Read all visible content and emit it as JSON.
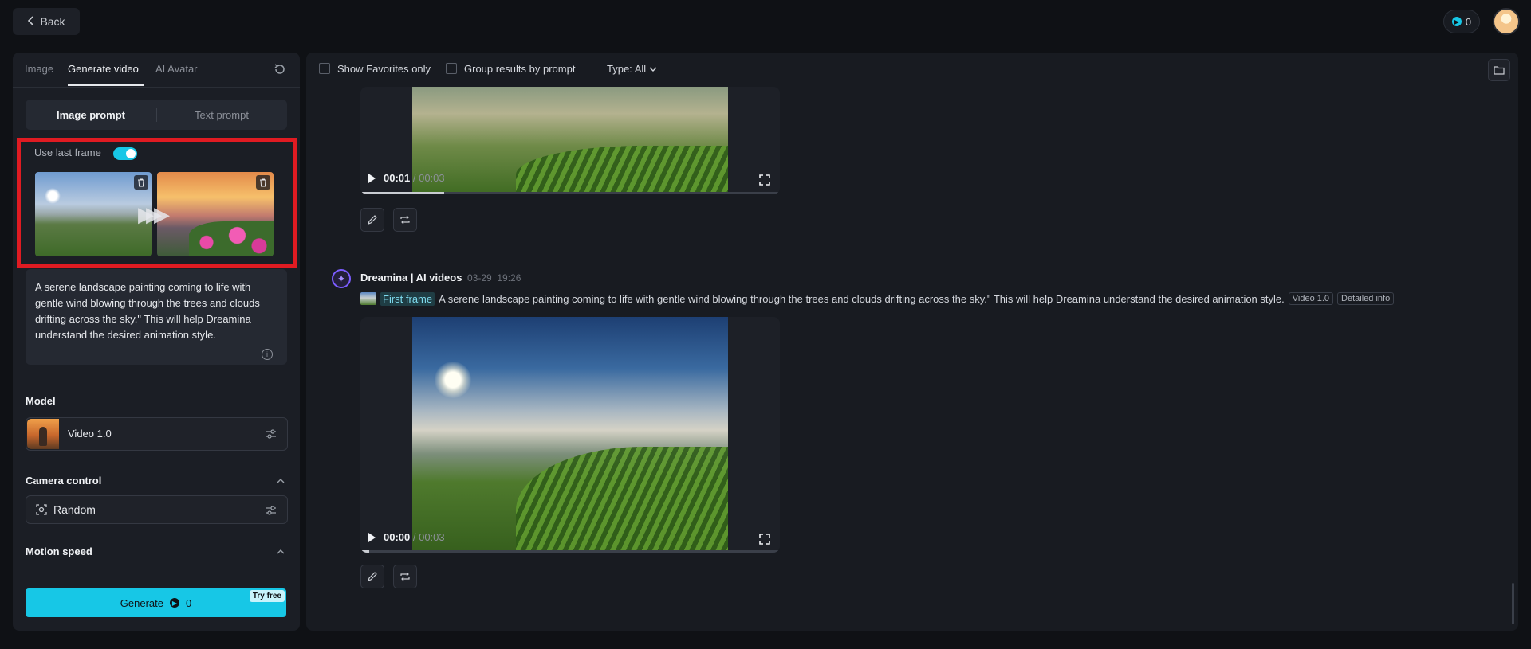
{
  "topbar": {
    "back_label": "Back",
    "credits": "0"
  },
  "left_panel": {
    "tabs": [
      {
        "label": "Image"
      },
      {
        "label": "Generate video"
      },
      {
        "label": "AI Avatar"
      }
    ],
    "prompt_modes": {
      "image": "Image prompt",
      "text": "Text prompt"
    },
    "use_last_frame_label": "Use last frame",
    "use_last_frame_on": true,
    "prompt_text": "A serene landscape painting coming to life with gentle wind blowing through the trees and clouds drifting across the sky.\" This will help Dreamina understand the desired animation style.",
    "model_title": "Model",
    "model_name": "Video 1.0",
    "camera_title": "Camera control",
    "camera_value": "Random",
    "motion_title": "Motion speed",
    "generate_label": "Generate",
    "generate_cost": "0",
    "try_free": "Try free"
  },
  "filters": {
    "favorites": "Show Favorites only",
    "group": "Group results by prompt",
    "type": "Type: All"
  },
  "results": {
    "video_top": {
      "current": "00:01",
      "duration": "/ 00:03",
      "progress": 0.2
    },
    "message": {
      "author": "Dreamina | AI videos",
      "date": "03-29",
      "time": "19:26",
      "first_frame_label": "First frame",
      "prompt": "A serene landscape painting coming to life with gentle wind blowing through the trees and clouds drifting across the sky.\" This will help Dreamina understand the desired animation style.",
      "tag_model": "Video 1.0",
      "tag_info": "Detailed info"
    },
    "video_main": {
      "current": "00:00",
      "duration": "/ 00:03",
      "progress": 0.02
    }
  },
  "colors": {
    "accent": "#17c7e6",
    "highlight": "#e01b22",
    "background": "#0f1115"
  }
}
